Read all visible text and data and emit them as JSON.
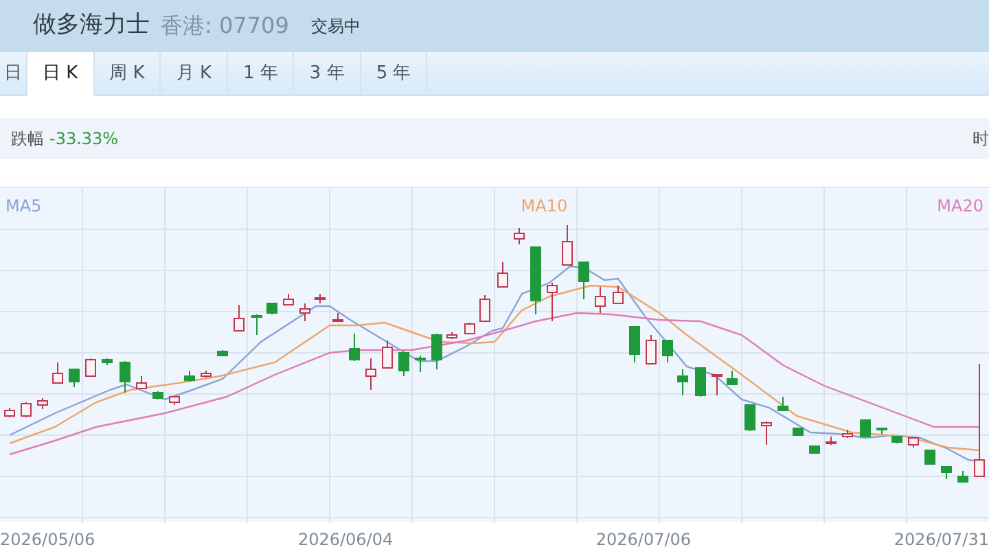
{
  "header": {
    "title": "做多海力士",
    "market": "香港: 07709",
    "status": "交易中"
  },
  "tabs": [
    {
      "label": "日",
      "selected": false
    },
    {
      "label": "日 K",
      "selected": true
    },
    {
      "label": "周 K",
      "selected": false
    },
    {
      "label": "月 K",
      "selected": false
    },
    {
      "label": "1 年",
      "selected": false
    },
    {
      "label": "3 年",
      "selected": false
    },
    {
      "label": "5 年",
      "selected": false
    }
  ],
  "info_bar": {
    "change_label": "跌幅",
    "change_value": "-33.33%",
    "time_label": "时"
  },
  "chart": {
    "legend": [
      {
        "label": "MA5",
        "color": "#8aa3d6"
      },
      {
        "label": "MA10",
        "color": "#eea56a"
      },
      {
        "label": "MA20",
        "color": "#df7cb8"
      }
    ],
    "date_labels": [
      "2026/05/06",
      "2026/06/04",
      "2026/07/06",
      "2026/07/31"
    ]
  }
}
